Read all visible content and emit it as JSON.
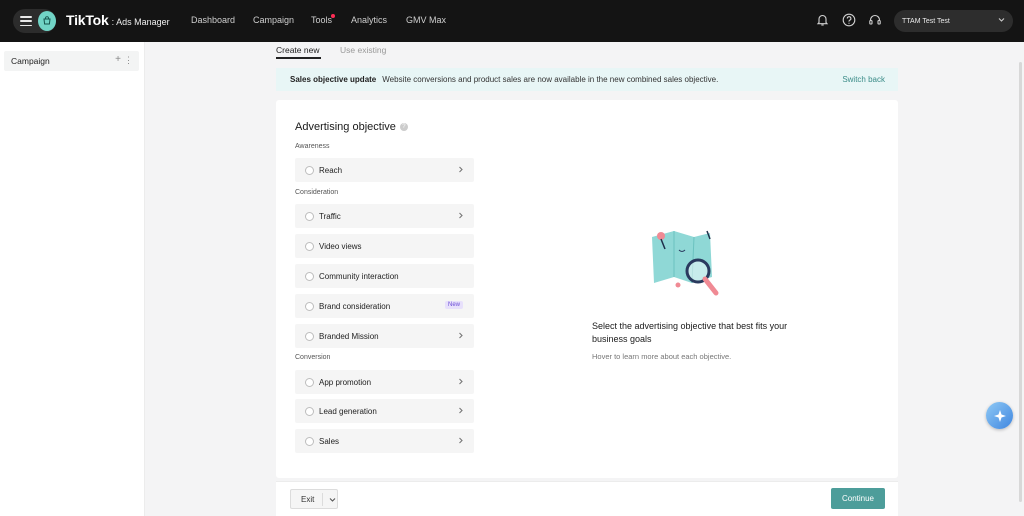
{
  "topbar": {
    "brand_main": "TikTok",
    "brand_sub": ": Ads Manager",
    "nav": [
      "Dashboard",
      "Campaign",
      "Tools",
      "Analytics",
      "GMV Max"
    ],
    "account_name": "TTAM Test Test",
    "icons": [
      "menu-icon",
      "shop-icon",
      "bell-icon",
      "help-icon",
      "headset-icon",
      "chevron-down-icon"
    ]
  },
  "sidebar": {
    "items": [
      {
        "label": "Campaign"
      }
    ]
  },
  "tabs": {
    "create_new": "Create new",
    "use_existing": "Use existing"
  },
  "banner": {
    "title": "Sales objective update",
    "text": "Website conversions and product sales are now available in the new combined sales objective.",
    "link": "Switch back"
  },
  "objective": {
    "title": "Advertising objective",
    "groups": [
      {
        "label": "Awareness",
        "options": [
          {
            "label": "Reach",
            "chevron": true
          }
        ]
      },
      {
        "label": "Consideration",
        "options": [
          {
            "label": "Traffic",
            "chevron": true
          },
          {
            "label": "Video views",
            "chevron": false
          },
          {
            "label": "Community interaction",
            "chevron": false
          },
          {
            "label": "Brand consideration",
            "chevron": false,
            "badge": "New"
          },
          {
            "label": "Branded Mission",
            "chevron": true
          }
        ]
      },
      {
        "label": "Conversion",
        "options": [
          {
            "label": "App promotion",
            "chevron": true
          },
          {
            "label": "Lead generation",
            "chevron": true
          },
          {
            "label": "Sales",
            "chevron": true
          }
        ]
      }
    ]
  },
  "empty_state": {
    "title": "Select the advertising objective that best fits your business goals",
    "subtitle": "Hover to learn more about each objective."
  },
  "footer": {
    "exit_label": "Exit",
    "continue_label": "Continue"
  },
  "colors": {
    "accent": "#4d9d9a",
    "banner_bg": "#e8f6f6",
    "topbar_bg": "#141414",
    "badge_bg": "#e7e0fb"
  }
}
